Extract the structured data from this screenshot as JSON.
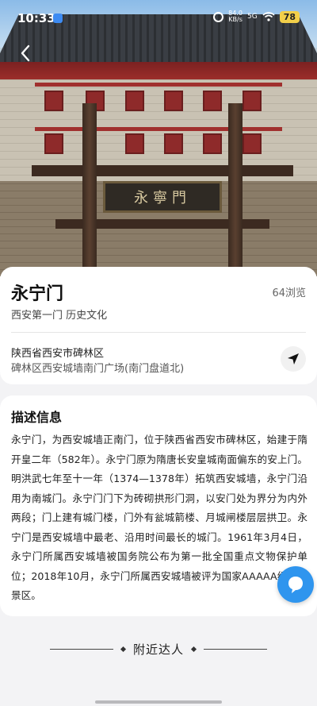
{
  "status_bar": {
    "time": "10:33",
    "net_speed_value": "84.0",
    "net_speed_unit": "KB/s",
    "signal": "5G",
    "battery": "78"
  },
  "hero": {
    "plaque_text": "永寧門"
  },
  "place": {
    "name": "永宁门",
    "views": "64浏览",
    "tags": "西安第一门 历史文化",
    "address_line1": "陕西省西安市碑林区",
    "address_line2": "碑林区西安城墙南门广场(南门盘道北)"
  },
  "description": {
    "title": "描述信息",
    "body": "永宁门，为西安城墙正南门，位于陕西省西安市碑林区，始建于隋开皇二年（582年）。永宁门原为隋唐长安皇城南面偏东的安上门。明洪武七年至十一年（1374—1378年）拓筑西安城墙，永宁门沿用为南城门。永宁门门下为砖砌拱形门洞，以安门处为界分为内外两段；门上建有城门楼，门外有瓮城箭楼、月城闸楼层层拱卫。永宁门是西安城墙中最老、沿用时间最长的城门。1961年3月4日，永宁门所属西安城墙被国务院公布为第一批全国重点文物保护单位；2018年10月，永宁门所属西安城墙被评为国家AAAAA级旅游景区。"
  },
  "nearby": {
    "label": "附近达人"
  },
  "colors": {
    "accent_blue": "#2f95ee",
    "battery": "#f2cf4a"
  },
  "icons": [
    "back-arrow-icon",
    "navigation-arrow-icon",
    "chat-bubble-icon",
    "wifi-icon",
    "clock-icon"
  ]
}
